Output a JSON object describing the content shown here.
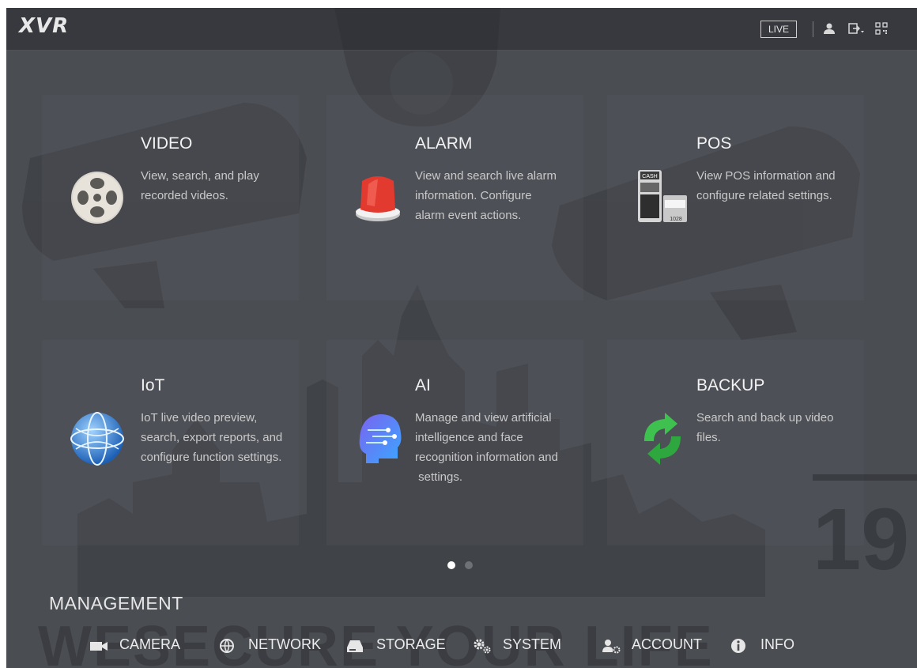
{
  "header": {
    "logo": "XVR",
    "live_label": "LIVE",
    "icons": [
      "user-icon",
      "logout-icon",
      "qr-code-icon"
    ]
  },
  "tiles": [
    {
      "id": "video",
      "title": "VIDEO",
      "desc": [
        "View, search, and play",
        "recorded videos."
      ],
      "icon": "film-reel-icon"
    },
    {
      "id": "alarm",
      "title": "ALARM",
      "desc": [
        "View and search live alarm",
        "information. Configure",
        "alarm event actions."
      ],
      "icon": "alarm-siren-icon"
    },
    {
      "id": "pos",
      "title": "POS",
      "desc": [
        "View POS information and",
        "configure related settings."
      ],
      "icon": "cash-register-icon"
    },
    {
      "id": "iot",
      "title": "IoT",
      "desc": [
        "IoT live video preview,",
        "search, export reports, and",
        "configure function settings."
      ],
      "icon": "globe-icon"
    },
    {
      "id": "ai",
      "title": "AI",
      "desc": [
        "Manage and view artificial",
        "intelligence and face",
        "recognition information and",
        " settings."
      ],
      "icon": "ai-brain-icon"
    },
    {
      "id": "backup",
      "title": "BACKUP",
      "desc": [
        "Search and back up video",
        "files."
      ],
      "icon": "sync-arrows-icon"
    }
  ],
  "pager": {
    "pages": 2,
    "active": 1
  },
  "management": {
    "title": "MANAGEMENT",
    "items": [
      {
        "id": "camera",
        "label": "CAMERA",
        "icon": "camera-icon"
      },
      {
        "id": "network",
        "label": "NETWORK",
        "icon": "network-globe-icon"
      },
      {
        "id": "storage",
        "label": "STORAGE",
        "icon": "hard-drive-icon"
      },
      {
        "id": "system",
        "label": "SYSTEM",
        "icon": "gears-icon"
      },
      {
        "id": "account",
        "label": "ACCOUNT",
        "icon": "user-settings-icon"
      },
      {
        "id": "info",
        "label": "INFO",
        "icon": "info-icon"
      }
    ]
  },
  "background": {
    "watermark_text_1": "WESECURE YOUR LIFE",
    "watermark_text_2": "19"
  }
}
